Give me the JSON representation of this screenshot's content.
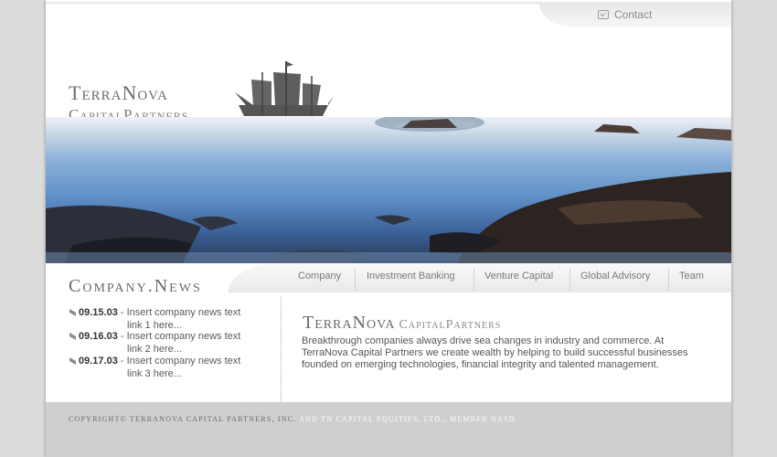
{
  "header": {
    "contact_label": "Contact"
  },
  "logo": {
    "line1": "TerraNova",
    "line2": "CapitalPartners"
  },
  "nav": {
    "items": [
      "Company",
      "Investment Banking",
      "Venture Capital",
      "Global Advisory",
      "Team"
    ]
  },
  "news": {
    "title": "Company.News",
    "items": [
      {
        "date": "09.15.03",
        "text_a": "Insert company news text",
        "text_b": "link 1 here..."
      },
      {
        "date": "09.16.03",
        "text_a": "Insert company news text",
        "text_b": "link 2 here..."
      },
      {
        "date": "09.17.03",
        "text_a": "Insert company news text",
        "text_b": "link 3 here..."
      }
    ]
  },
  "main": {
    "brand_a": "TerraNova",
    "brand_b": "CapitalPartners",
    "description": "Breakthrough companies always drive sea changes in industry and commerce. At TerraNova Capital Partners we create wealth by helping to build successful businesses founded on emerging technologies, financial integrity and talented management."
  },
  "footer": {
    "copyright_a": "COPYRIGHT© TERRANOVA CAPITAL PARTNERS, INC.",
    "copyright_b": "AND TN CAPITAL EQUITIES, LTD., MEMBER NASD"
  },
  "icons": {
    "contact": "envelope-icon",
    "ship": "ship-icon",
    "bullet": "pencil-bullet-icon"
  }
}
